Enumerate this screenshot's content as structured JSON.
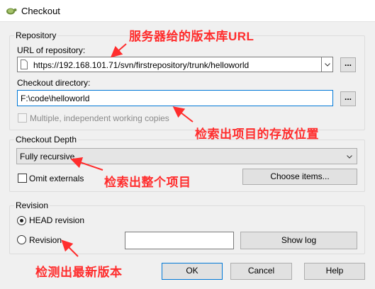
{
  "window": {
    "title": "Checkout"
  },
  "repository": {
    "group_label": "Repository",
    "url_label": "URL of repository:",
    "url_value": "https://192.168.101.71/svn/firstrepository/trunk/helloworld",
    "checkout_dir_label": "Checkout directory:",
    "checkout_dir_value": "F:\\code\\helloworld",
    "browse_label": "...",
    "multiple_copies_label": "Multiple, independent working copies"
  },
  "depth": {
    "group_label": "Checkout Depth",
    "selected": "Fully recursive",
    "omit_externals_label": "Omit externals",
    "choose_items_label": "Choose items..."
  },
  "revision": {
    "group_label": "Revision",
    "head_label": "HEAD revision",
    "revision_label": "Revision",
    "revision_value": "",
    "show_log_label": "Show log"
  },
  "buttons": {
    "ok": "OK",
    "cancel": "Cancel",
    "help": "Help"
  },
  "annotations": {
    "url": "服务器给的版本库URL",
    "dir": "检索出项目的存放位置",
    "depth": "检索出整个项目",
    "revision": "检测出最新版本"
  },
  "colors": {
    "annotation": "#ff2d2d",
    "focus": "#0078d7"
  }
}
